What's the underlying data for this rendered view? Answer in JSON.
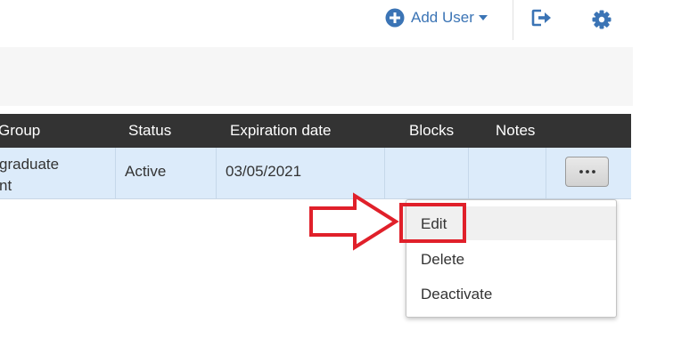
{
  "header": {
    "add_user_label": "Add User",
    "icons": [
      "plus-circle-icon",
      "caret-down-icon",
      "logout-icon",
      "gear-icon"
    ]
  },
  "table": {
    "columns": [
      "Group",
      "Status",
      "Expiration date",
      "Blocks",
      "Notes"
    ],
    "rows": [
      {
        "group_line1": "graduate",
        "group_line2": "nt",
        "status": "Active",
        "expiration_date": "03/05/2021",
        "blocks": "",
        "notes": ""
      }
    ]
  },
  "row_actions_menu": {
    "items": [
      "Edit",
      "Delete",
      "Deactivate"
    ],
    "highlighted_item": "Edit"
  },
  "colors": {
    "accent": "#3b74b5",
    "header_bg": "#333333",
    "row_selected_bg": "#dcebfa",
    "callout_red": "#e0202a"
  }
}
